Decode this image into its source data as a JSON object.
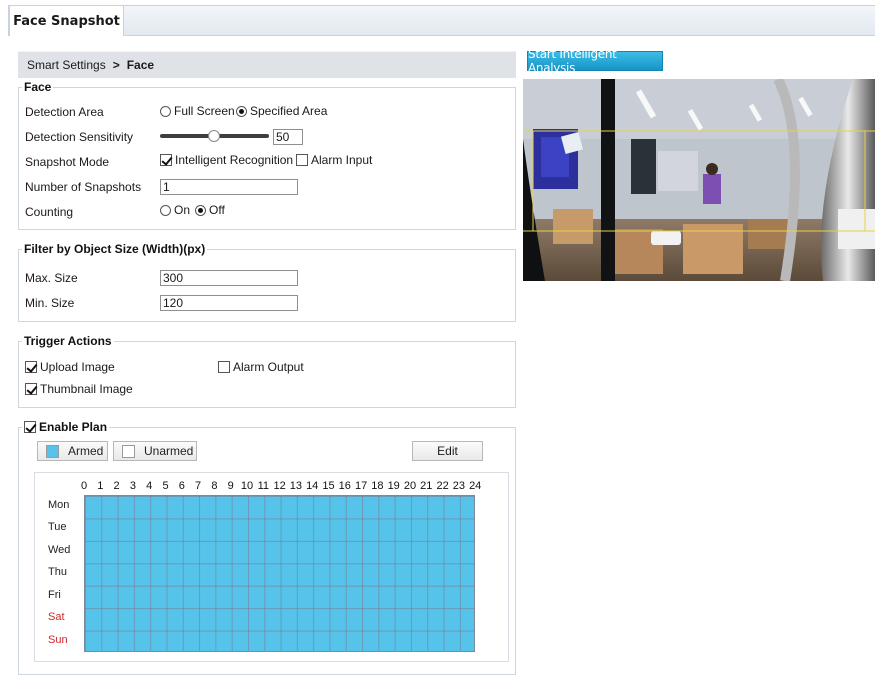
{
  "tab": {
    "title": "Face Snapshot"
  },
  "breadcrumb": {
    "parent": "Smart Settings",
    "separator": ">",
    "current": "Face"
  },
  "face_group": {
    "legend": "Face",
    "detection_area": {
      "label": "Detection Area",
      "options": [
        "Full Screen",
        "Specified Area"
      ],
      "selected": "Specified Area"
    },
    "sensitivity": {
      "label": "Detection Sensitivity",
      "value": "50",
      "level_fraction": 0.5
    },
    "snapshot_mode": {
      "label": "Snapshot Mode",
      "intelligent": "Intelligent Recognition",
      "intelligent_checked": true,
      "alarm": "Alarm Input",
      "alarm_checked": false
    },
    "num_snapshots": {
      "label": "Number of Snapshots",
      "value": "1"
    },
    "counting": {
      "label": "Counting",
      "options": [
        "On",
        "Off"
      ],
      "selected": "Off"
    }
  },
  "filter_group": {
    "legend": "Filter by Object Size (Width)(px)",
    "max": {
      "label": "Max. Size",
      "value": "300"
    },
    "min": {
      "label": "Min. Size",
      "value": "120"
    }
  },
  "trigger_group": {
    "legend": "Trigger Actions",
    "upload_image": {
      "label": "Upload Image",
      "checked": true
    },
    "thumbnail_image": {
      "label": "Thumbnail Image",
      "checked": true
    },
    "alarm_output": {
      "label": "Alarm Output",
      "checked": false
    }
  },
  "plan_group": {
    "legend": "Enable Plan",
    "enabled": true,
    "armed_label": "Armed",
    "unarmed_label": "Unarmed",
    "edit_label": "Edit",
    "hours": [
      "0",
      "1",
      "2",
      "3",
      "4",
      "5",
      "6",
      "7",
      "8",
      "9",
      "10",
      "11",
      "12",
      "13",
      "14",
      "15",
      "16",
      "17",
      "18",
      "19",
      "20",
      "21",
      "22",
      "23",
      "24"
    ],
    "days": [
      "Mon",
      "Tue",
      "Wed",
      "Thu",
      "Fri",
      "Sat",
      "Sun"
    ],
    "all_armed": true
  },
  "analysis": {
    "button_label": "Start Intelligent Analysis"
  },
  "colors": {
    "armed": "#56c3ea",
    "accent": "#1696c8",
    "weekend": "#d0272b",
    "detection_line": "#e6d24a"
  }
}
